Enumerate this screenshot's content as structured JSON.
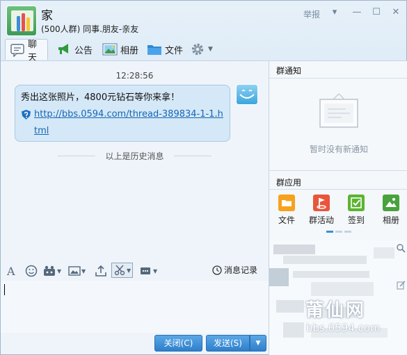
{
  "header": {
    "group_name": "家",
    "group_meta": "(500人群) 同事.朋友-亲友",
    "report_label": "举报"
  },
  "tabs": [
    {
      "label": "聊天",
      "icon": "chat-icon"
    },
    {
      "label": "公告",
      "icon": "announcement-icon"
    },
    {
      "label": "相册",
      "icon": "album-icon"
    },
    {
      "label": "文件",
      "icon": "folder-icon"
    }
  ],
  "chat": {
    "timestamp": "12:28:56",
    "message_text": "秀出这张照片，4800元钻石等你来拿！",
    "message_link": "http://bbs.0594.com/thread-389834-1-1.html",
    "history_divider": "以上是历史消息"
  },
  "sidebar": {
    "notice_title": "群通知",
    "no_notice_text": "暂时没有新通知",
    "apps_title": "群应用",
    "apps": [
      {
        "label": "文件",
        "color": "#f6a21d"
      },
      {
        "label": "群活动",
        "color": "#e8553b"
      },
      {
        "label": "签到",
        "color": "#5cb431"
      },
      {
        "label": "相册",
        "color": "#49a23c"
      }
    ]
  },
  "toolbar": {
    "message_record_label": "消息记录"
  },
  "buttons": {
    "close_label": "关闭(C)",
    "send_label": "发送(S)"
  },
  "watermark": {
    "title": "莆仙网",
    "url": "bbs.0594.com"
  },
  "colors": {
    "accent": "#2e7fcb",
    "link": "#1566b4",
    "bubble": "#d5e8f7"
  }
}
